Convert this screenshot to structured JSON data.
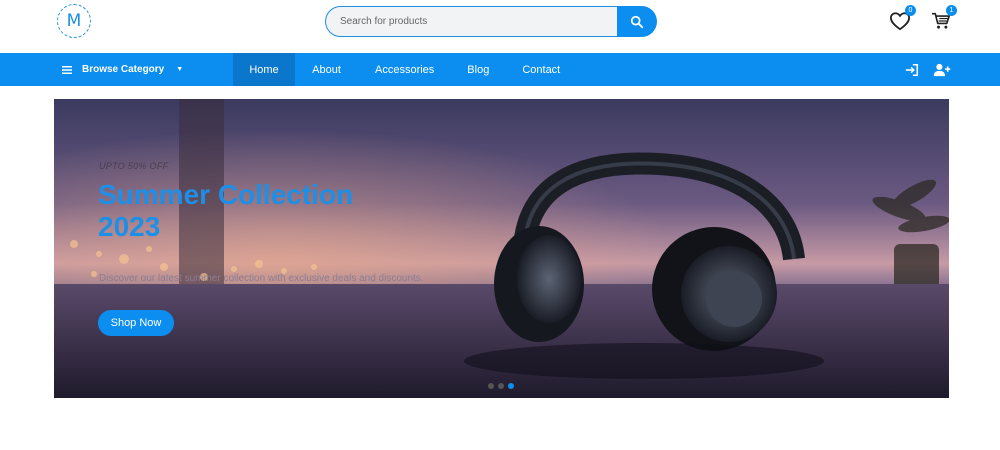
{
  "header": {
    "logo_letter": "M",
    "search": {
      "placeholder": "Search for products",
      "value": ""
    },
    "wishlist": {
      "count": "0",
      "icon": "heart-icon"
    },
    "cart": {
      "count": "1",
      "icon": "cart-icon"
    }
  },
  "nav": {
    "browse_label": "Browse Category",
    "links": [
      {
        "label": "Home",
        "active": true
      },
      {
        "label": "About",
        "active": false
      },
      {
        "label": "Accessories",
        "active": false
      },
      {
        "label": "Blog",
        "active": false
      },
      {
        "label": "Contact",
        "active": false
      }
    ],
    "right_icons": [
      "login-icon",
      "add-user-icon"
    ]
  },
  "hero": {
    "eyebrow": "UPTO 50% OFF",
    "title": "Summer Collection 2023",
    "description": "Discover our latest summer collection with exclusive deals and discounts.",
    "button_label": "Shop Now",
    "slides": 3,
    "active_slide": 3
  },
  "colors": {
    "accent": "#0b8ef0",
    "nav_active": "#0a76cc",
    "title": "#1e8fe6"
  }
}
